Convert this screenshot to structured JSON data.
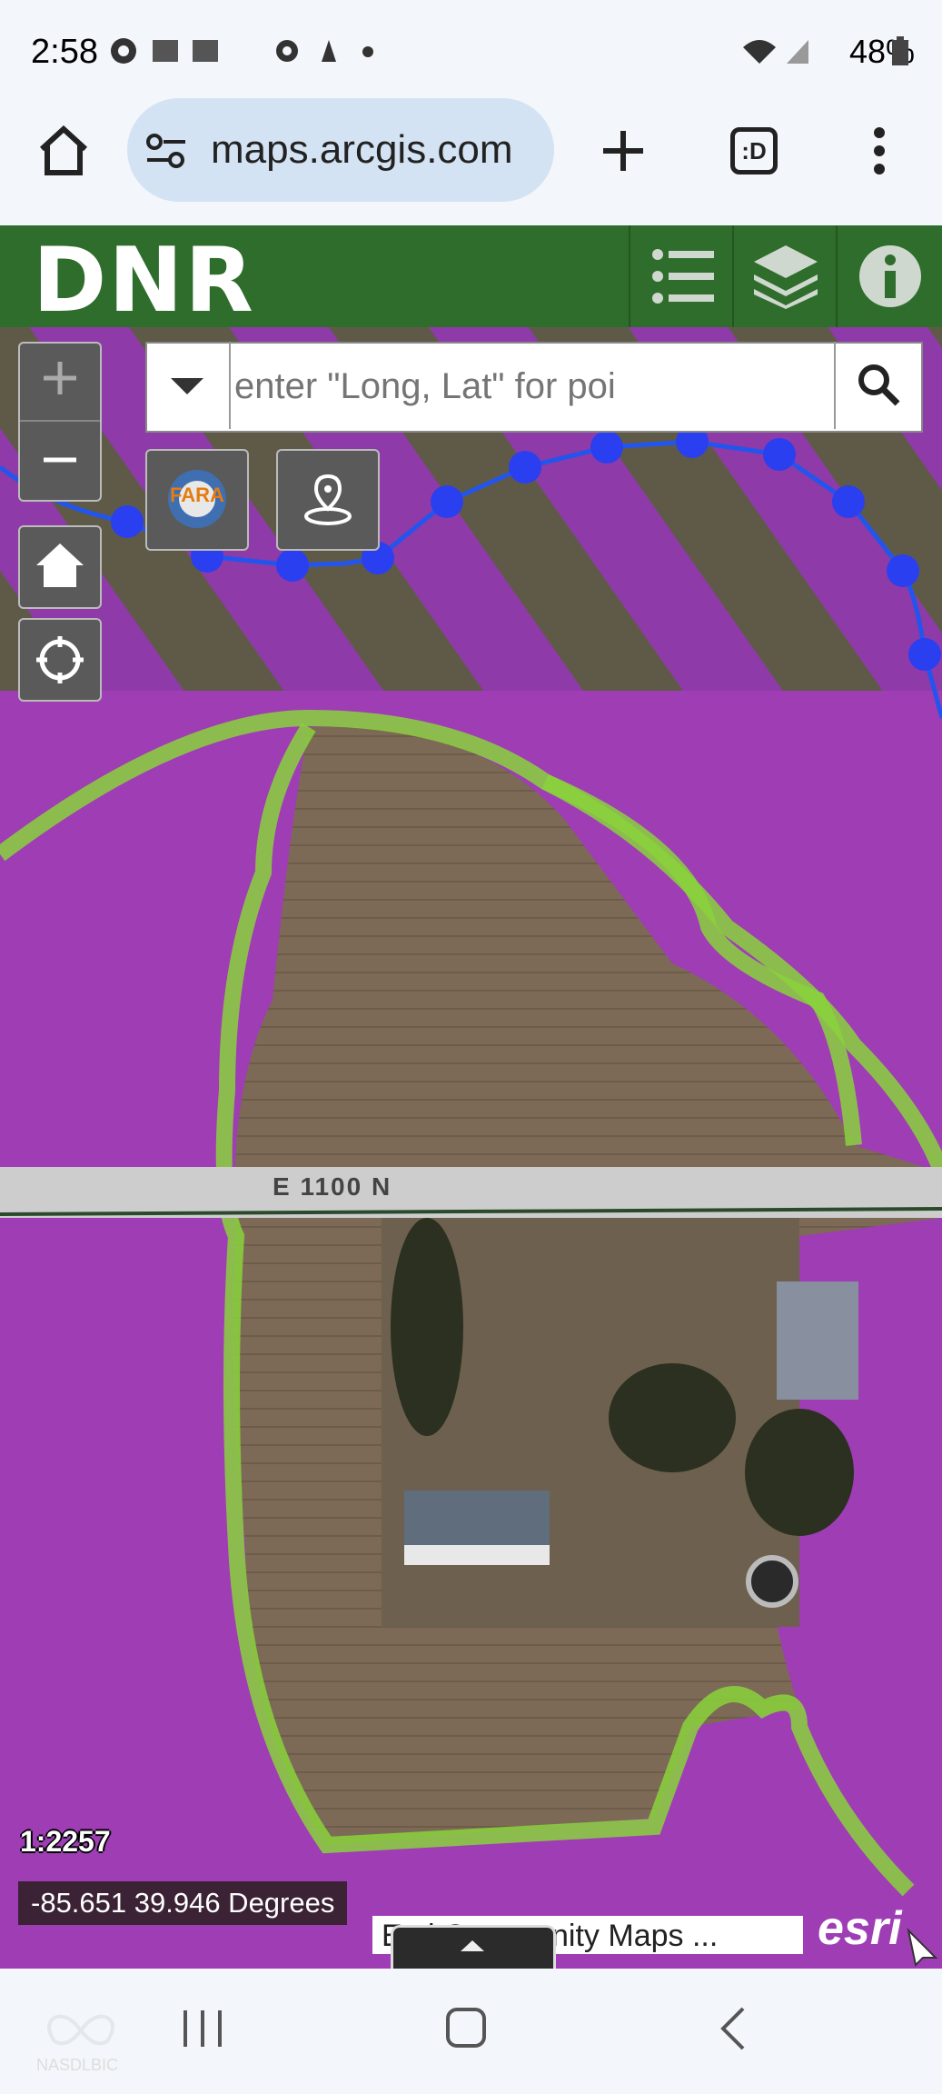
{
  "status_bar": {
    "time": "2:58",
    "battery": "48%"
  },
  "browser": {
    "url": "maps.arcgis.com",
    "tabs_badge": ":D"
  },
  "app": {
    "logo": "DNR",
    "header_buttons": [
      "list-icon",
      "layers-icon",
      "info-icon"
    ]
  },
  "map": {
    "search_placeholder": "enter \"Long, Lat\" for poi",
    "fara_label": "FARA",
    "road_label": "E 1100 N",
    "scale": "1:2257",
    "coordinates": "-85.651 39.946 Degrees",
    "attribution": "Esri Community Maps ...",
    "esri_logo": "esri"
  },
  "nav_bar": {
    "watermark": "NASDLBIC"
  },
  "colors": {
    "header_green": "#2f6d2c",
    "overlay_purple": "#9b2fb0",
    "boundary_green": "#8ad23c",
    "line_blue": "#2255ee"
  }
}
